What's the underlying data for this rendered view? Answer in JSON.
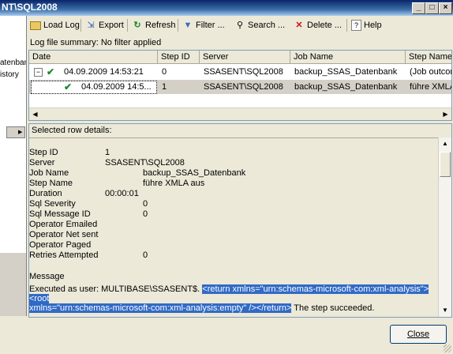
{
  "window": {
    "title": "NT\\SQL2008",
    "min": "_",
    "max": "□",
    "close": "×"
  },
  "left_panel": {
    "items": [
      "atenbank",
      "istory"
    ]
  },
  "toolbar": {
    "load_log": "Load Log",
    "export": "Export",
    "refresh": "Refresh",
    "filter": "Filter ...",
    "search": "Search ...",
    "delete": "Delete ...",
    "help": "Help"
  },
  "summary": "Log file summary: No filter applied",
  "grid": {
    "columns": [
      "Date",
      "Step ID",
      "Server",
      "Job Name",
      "Step Name"
    ],
    "rows": [
      {
        "date": "04.09.2009 14:53:21",
        "step_id": "0",
        "server": "SSASENT\\SQL2008",
        "job": "backup_SSAS_Datenbank",
        "step": "(Job outcome)"
      },
      {
        "date": "04.09.2009 14:5...",
        "step_id": "1",
        "server": "SSASENT\\SQL2008",
        "job": "backup_SSAS_Datenbank",
        "step": "führe XMLA aus"
      }
    ]
  },
  "details": {
    "header": "Selected row details:",
    "fields": [
      {
        "key": "Step ID",
        "value": "1"
      },
      {
        "key": "Server",
        "value": "SSASENT\\SQL2008"
      },
      {
        "key": "Job Name",
        "value": "backup_SSAS_Datenbank"
      },
      {
        "key": "Step Name",
        "value": "führe XMLA aus"
      },
      {
        "key": "Duration",
        "value": "00:00:01"
      },
      {
        "key": "Sql Severity",
        "value": "0"
      },
      {
        "key": "Sql Message ID",
        "value": "0"
      },
      {
        "key": "Operator Emailed",
        "value": ""
      },
      {
        "key": "Operator Net sent",
        "value": ""
      },
      {
        "key": "Operator Paged",
        "value": ""
      },
      {
        "key": "Retries Attempted",
        "value": "0"
      }
    ],
    "message_label": "Message",
    "message_prefix": "Executed as user: MULTIBASE\\SSASENT$. ",
    "message_highlight_1": "<return xmlns=\"urn:schemas-microsoft-com:xml-analysis\"><root",
    "message_highlight_2": "xmlns=\"urn:schemas-microsoft-com:xml-analysis:empty\" /></return>",
    "message_suffix": "  The step succeeded."
  },
  "close_button": "Close"
}
